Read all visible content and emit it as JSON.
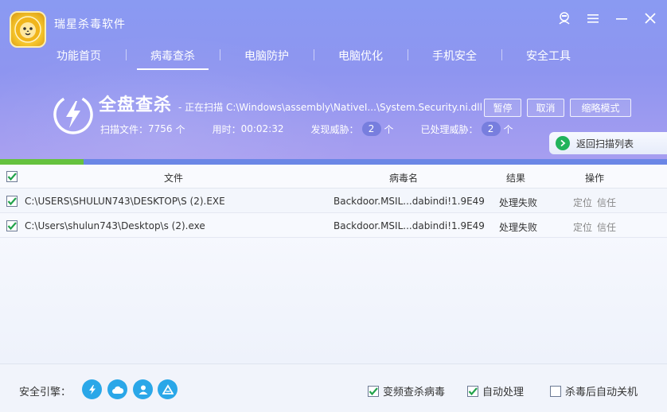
{
  "app": {
    "title": "瑞星杀毒软件"
  },
  "nav": {
    "tabs": [
      {
        "label": "功能首页",
        "active": false
      },
      {
        "label": "病毒查杀",
        "active": true
      },
      {
        "label": "电脑防护",
        "active": false
      },
      {
        "label": "电脑优化",
        "active": false
      },
      {
        "label": "手机安全",
        "active": false
      },
      {
        "label": "安全工具",
        "active": false
      }
    ]
  },
  "window_controls": [
    "user-icon",
    "menu-icon",
    "minimize-icon",
    "close-icon"
  ],
  "scan": {
    "title": "全盘查杀",
    "path": "- 正在扫描 C:\\Windows\\assembly\\NativeI...\\System.Security.ni.dll",
    "files_label": "扫描文件：",
    "files_value": "7756",
    "files_unit": "个",
    "time_label": "用时：",
    "time_value": "00:02:32",
    "found_label": "发现威胁：",
    "found_value": "2",
    "found_unit": "个",
    "handled_label": "已处理威胁：",
    "handled_value": "2",
    "handled_unit": "个",
    "progress_percent": 12.5
  },
  "buttons": {
    "pause": "暂停",
    "cancel": "取消",
    "mini": "缩略模式",
    "back_list": "返回扫描列表"
  },
  "table": {
    "headers": {
      "file": "文件",
      "virus": "病毒名",
      "result": "结果",
      "action": "操作"
    },
    "rows": [
      {
        "file": "C:\\USERS\\SHULUN743\\DESKTOP\\S (2).EXE",
        "virus": "Backdoor.MSIL...dabindi!1.9E49",
        "result": "处理失败",
        "locate": "定位",
        "trust": "信任"
      },
      {
        "file": "C:\\Users\\shulun743\\Desktop\\s (2).exe",
        "virus": "Backdoor.MSIL...dabindi!1.9E49",
        "result": "处理失败",
        "locate": "定位",
        "trust": "信任"
      }
    ]
  },
  "footer": {
    "engine_label": "安全引擎：",
    "engines": [
      "lightning-icon",
      "cloud-icon",
      "user-icon",
      "mountain-icon"
    ],
    "options": [
      {
        "label": "变频查杀病毒",
        "checked": true
      },
      {
        "label": "自动处理",
        "checked": true
      },
      {
        "label": "杀毒后自动关机",
        "checked": false
      }
    ]
  },
  "colors": {
    "accent": "#8a9af2",
    "progress": "#66c23f",
    "engine": "#2aa7e8",
    "check": "#21a24a"
  }
}
